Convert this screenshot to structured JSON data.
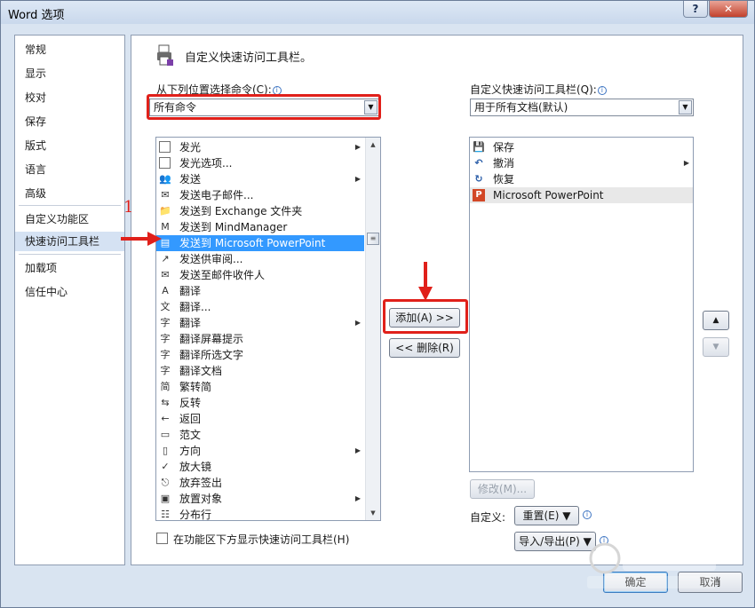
{
  "window": {
    "title": "Word 选项",
    "help_label": "?",
    "close_label": "✕"
  },
  "sidebar": {
    "items": [
      {
        "label": "常规"
      },
      {
        "label": "显示"
      },
      {
        "label": "校对"
      },
      {
        "label": "保存"
      },
      {
        "label": "版式"
      },
      {
        "label": "语言"
      },
      {
        "label": "高级"
      },
      {
        "label": "自定义功能区"
      },
      {
        "label": "快速访问工具栏",
        "active": true
      },
      {
        "label": "加载项"
      },
      {
        "label": "信任中心"
      }
    ]
  },
  "main": {
    "header": "自定义快速访问工具栏。",
    "choose_label": "从下列位置选择命令(C):",
    "choose_value": "所有命令",
    "customize_label": "自定义快速访问工具栏(Q):",
    "customize_value": "用于所有文档(默认)",
    "commands": [
      {
        "label": "发光",
        "icon": "checkbox-icon",
        "glyph": "",
        "submenu": true
      },
      {
        "label": "发光选项...",
        "icon": "checkbox-icon",
        "glyph": ""
      },
      {
        "label": "发送",
        "icon": "send-people-icon",
        "glyph": "👥",
        "submenu": true
      },
      {
        "label": "发送电子邮件...",
        "icon": "email-doc-icon",
        "glyph": "✉"
      },
      {
        "label": "发送到 Exchange 文件夹",
        "icon": "exchange-folder-icon",
        "glyph": "📁"
      },
      {
        "label": "发送到 MindManager",
        "icon": "mindmanager-icon",
        "glyph": "M"
      },
      {
        "label": "发送到 Microsoft PowerPoint",
        "icon": "powerpoint-send-icon",
        "glyph": "▤",
        "selected": true
      },
      {
        "label": "发送供审阅...",
        "icon": "review-send-icon",
        "glyph": "↗"
      },
      {
        "label": "发送至邮件收件人",
        "icon": "mail-recipient-icon",
        "glyph": "✉"
      },
      {
        "label": "翻译",
        "icon": "translate-globe-icon",
        "glyph": "A"
      },
      {
        "label": "翻译...",
        "icon": "translate-doc-icon",
        "glyph": "文"
      },
      {
        "label": "翻译",
        "icon": "translate-menu-icon",
        "glyph": "字",
        "submenu": true
      },
      {
        "label": "翻译屏幕提示",
        "icon": "translate-tip-icon",
        "glyph": "字"
      },
      {
        "label": "翻译所选文字",
        "icon": "translate-selection-icon",
        "glyph": "字"
      },
      {
        "label": "翻译文档",
        "icon": "translate-document-icon",
        "glyph": "字"
      },
      {
        "label": "繁转简",
        "icon": "trad-to-simp-icon",
        "glyph": "简"
      },
      {
        "label": "反转",
        "icon": "reverse-icon",
        "glyph": "⇆"
      },
      {
        "label": "返回",
        "icon": "back-icon",
        "glyph": "←"
      },
      {
        "label": "范文",
        "icon": "sample-icon",
        "glyph": "▭"
      },
      {
        "label": "方向",
        "icon": "direction-icon",
        "glyph": "▯",
        "submenu": true
      },
      {
        "label": "放大镜",
        "icon": "magnifier-icon",
        "glyph": "✓"
      },
      {
        "label": "放弃签出",
        "icon": "discard-checkout-icon",
        "glyph": "⎋"
      },
      {
        "label": "放置对象",
        "icon": "place-object-icon",
        "glyph": "▣",
        "submenu": true
      },
      {
        "label": "分布行",
        "icon": "distribute-rows-icon",
        "glyph": "☷"
      }
    ],
    "toolbar_items": [
      {
        "label": "保存",
        "icon": "save-icon",
        "glyph": "💾"
      },
      {
        "label": "撤消",
        "icon": "undo-icon",
        "glyph": "↶",
        "submenu": true
      },
      {
        "label": "恢复",
        "icon": "redo-icon",
        "glyph": "↻"
      },
      {
        "label": "Microsoft PowerPoint",
        "icon": "powerpoint-icon",
        "glyph": "P",
        "highlighted": true
      }
    ],
    "add_button": "添加(A) >>",
    "remove_button": "<< 删除(R)",
    "modify_button": "修改(M)...",
    "customize_text": "自定义:",
    "reset_button": "重置(E) ▼",
    "import_export_button": "导入/导出(P) ▼",
    "show_below_label": "在功能区下方显示快速访问工具栏(H)",
    "ok_button": "确定",
    "cancel_button": "取消"
  },
  "annotations": {
    "step_number": "1"
  },
  "colors": {
    "selection": "#3399ff",
    "annotation_red": "#e0201a"
  }
}
